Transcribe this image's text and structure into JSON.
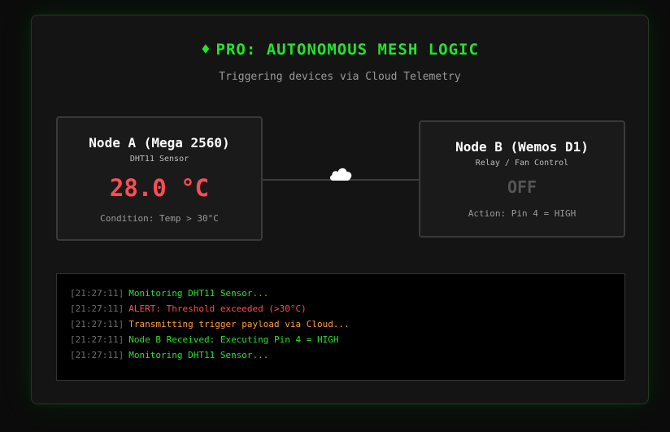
{
  "header": {
    "icon": "diamond-icon",
    "title": "PRO: AUTONOMOUS MESH LOGIC",
    "subtitle": "Triggering devices via Cloud Telemetry"
  },
  "node_a": {
    "title": "Node A (Mega 2560)",
    "subtitle": "DHT11 Sensor",
    "reading": "28.0 °C",
    "condition": "Condition: Temp > 30°C"
  },
  "node_b": {
    "title": "Node B (Wemos D1)",
    "subtitle": "Relay / Fan Control",
    "state": "OFF",
    "action": "Action: Pin 4 = HIGH"
  },
  "link": {
    "icon": "cloud-icon"
  },
  "log": [
    {
      "timestamp": "[21:27:11]",
      "message": "Monitoring DHT11 Sensor...",
      "level": "info"
    },
    {
      "timestamp": "[21:27:11]",
      "message": "ALERT: Threshold exceeded (>30°C)",
      "level": "alert"
    },
    {
      "timestamp": "[21:27:11]",
      "message": "Transmitting trigger payload via Cloud...",
      "level": "transmit"
    },
    {
      "timestamp": "[21:27:11]",
      "message": "Node B Received: Executing Pin 4 = HIGH",
      "level": "info"
    },
    {
      "timestamp": "[21:27:11]",
      "message": "Monitoring DHT11 Sensor...",
      "level": "info"
    }
  ],
  "colors": {
    "accent_green": "#22e42d",
    "alert_red": "#ff4d55",
    "transmit_orange": "#ff9e3d",
    "inactive_gray": "#555555"
  }
}
